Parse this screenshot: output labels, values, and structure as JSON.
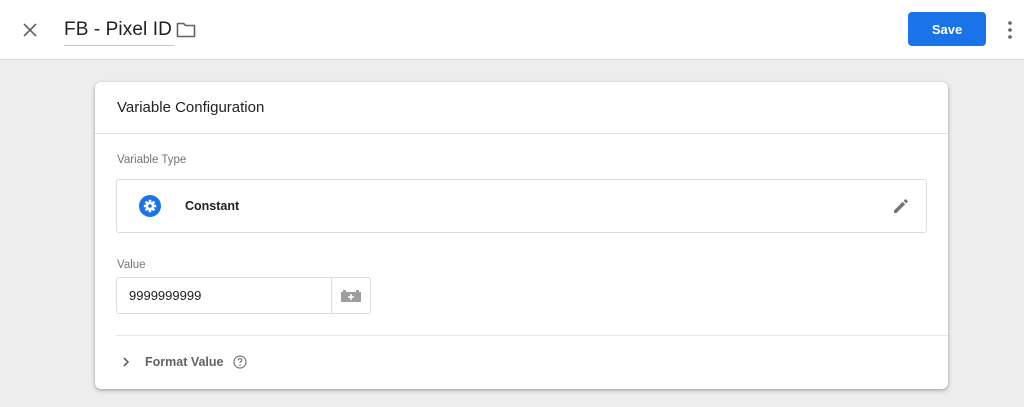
{
  "header": {
    "title": "FB - Pixel ID",
    "save_label": "Save",
    "icons": {
      "close": "close-icon",
      "folder": "folder-icon",
      "more": "more-vert-icon"
    }
  },
  "card": {
    "title": "Variable Configuration",
    "variable_type_label": "Variable Type",
    "variable_type": "Constant",
    "value_label": "Value",
    "value": "9999999999",
    "format_value_label": "Format Value"
  },
  "colors": {
    "accent": "#1a73e8",
    "background": "#ededed",
    "text": "#212121",
    "muted": "#757575"
  }
}
